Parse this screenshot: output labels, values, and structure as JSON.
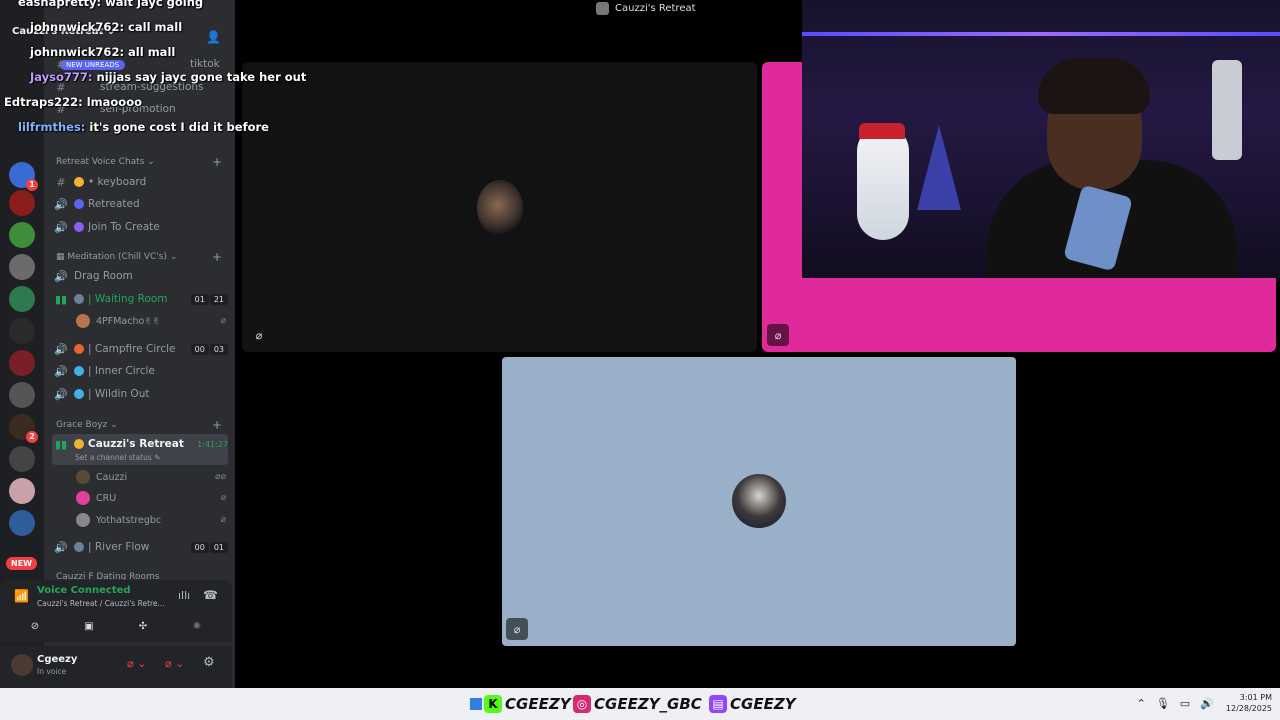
{
  "window": {
    "title": "Cauzzi's Retreat"
  },
  "server": {
    "name": "Cauzzi's Retreat",
    "new_unreads": "NEW UNREADS"
  },
  "rail": {
    "badges": [
      "1",
      "2"
    ],
    "new_label": "NEW"
  },
  "channels": {
    "top": [
      {
        "icon": "#",
        "label": "tiktok"
      },
      {
        "icon": "#",
        "label": "stream-suggestions"
      },
      {
        "icon": "#",
        "label": "self-promotion"
      }
    ],
    "categories": {
      "voice": "Retreat Voice Chats",
      "meditation": "Meditation (Chill VC's)",
      "grace": "Grace Boyz",
      "dating": "Cauzzi F Dating Rooms"
    },
    "voice_rows": [
      {
        "label": "• keyboard"
      },
      {
        "label": "Retreated"
      },
      {
        "label": "Join To Create"
      }
    ],
    "meditation_rows": [
      {
        "label": "Drag Room"
      },
      {
        "label": "| Waiting Room",
        "counts": [
          "01",
          "21"
        ]
      },
      {
        "label": "| Campfire Circle",
        "counts": [
          "00",
          "03"
        ]
      },
      {
        "label": "| Inner Circle"
      },
      {
        "label": "| Wildin Out"
      }
    ],
    "waiting_member": "4PFMacho✌✌",
    "active_channel": {
      "label": "Cauzzi's Retreat",
      "timer": "1:41:27",
      "status": "Set a channel status"
    },
    "members": [
      "Cauzzi",
      "CRU",
      "Yothatstregbc"
    ],
    "river_flow": {
      "label": "| River Flow",
      "counts": [
        "00",
        "01"
      ]
    }
  },
  "voice_panel": {
    "title": "Voice Connected",
    "sub": "Cauzzi's Retreat / Cauzzi's Retre..."
  },
  "user_panel": {
    "name": "Cgeezy",
    "status": "In voice"
  },
  "chat": [
    {
      "user": "eashapretty:",
      "text": "wait jayc going",
      "color": "#ffffff"
    },
    {
      "user": "johnnwick762:",
      "text": "call mall",
      "color": "#ffffff"
    },
    {
      "user": "johnnwick762:",
      "text": "all mall",
      "color": "#ffffff"
    },
    {
      "user": "Jayso777:",
      "text": "nijjas say jayc gone take her out",
      "color": "#c39bff"
    },
    {
      "user": "Edtraps222:",
      "text": "lmaoooo",
      "color": "#ffffff"
    },
    {
      "user": "lilfrmthes:",
      "text": "it's gone cost I did it before",
      "color": "#7fb2ff"
    }
  ],
  "taskbar": {
    "socials": [
      {
        "icon": "K",
        "handle": "CGEEZY",
        "color": "#53fc18"
      },
      {
        "icon": "◎",
        "handle": "CGEEZY_GBC",
        "color": "#d62976"
      },
      {
        "icon": "▤",
        "handle": "CGEEZY",
        "color": "#9146ff"
      }
    ],
    "time": "3:01 PM",
    "date": "12/28/2025"
  },
  "colors": {
    "accent_pink": "#e02a9b",
    "voice_green": "#23a55a",
    "tile_blue": "#9ab0c8"
  }
}
